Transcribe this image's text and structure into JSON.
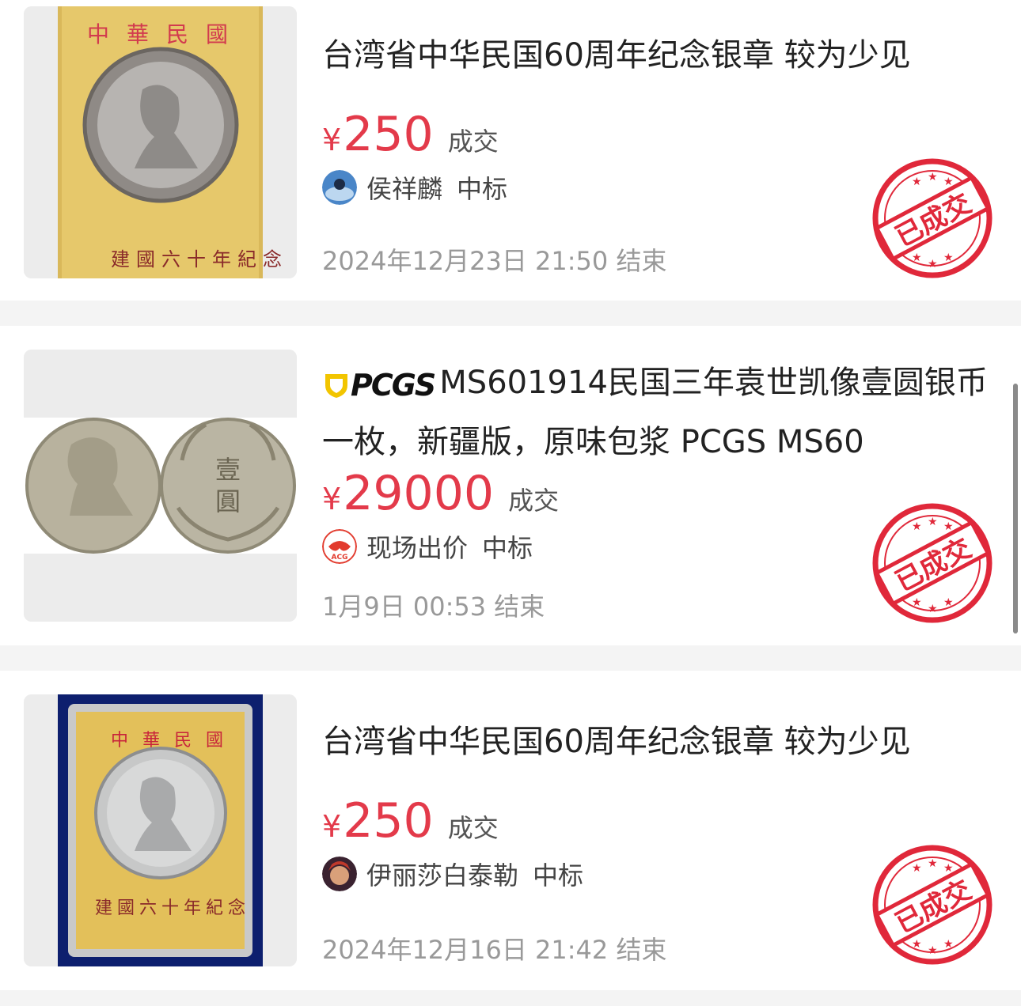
{
  "listings": [
    {
      "title": "台湾省中华民国60周年纪念银章 较为少见",
      "currency": "¥",
      "price": "250",
      "deal_label": "成交",
      "winner": "侯祥麟",
      "winner_tag": "中标",
      "end_time": "2024年12月23日 21:50 结束",
      "stamp": "已成交",
      "image": {
        "case_top": "中華民國",
        "case_bottom": "建國六十年紀念",
        "case_color": "#d9b85a"
      }
    },
    {
      "badge": "PCGS",
      "title": "MS601914民国三年袁世凯像壹圆银币一枚，新疆版，原味包浆 PCGS MS60",
      "currency": "¥",
      "price": "29000",
      "deal_label": "成交",
      "winner": "现场出价",
      "winner_tag": "中标",
      "avatar_text": "ACG",
      "end_time": "1月9日 00:53 结束",
      "stamp": "已成交",
      "image": {
        "coin_reverse": "壹圓"
      }
    },
    {
      "title": "台湾省中华民国60周年纪念银章 较为少见",
      "currency": "¥",
      "price": "250",
      "deal_label": "成交",
      "winner": "伊丽莎白泰勒",
      "winner_tag": "中标",
      "end_time": "2024年12月16日 21:42 结束",
      "stamp": "已成交",
      "image": {
        "case_top": "中華民國",
        "case_bottom": "建國六十年紀念",
        "case_color": "#e3c05a"
      }
    }
  ],
  "colors": {
    "price": "#e33a4a",
    "stamp": "#e0283a",
    "text": "#222222",
    "muted": "#999999"
  }
}
